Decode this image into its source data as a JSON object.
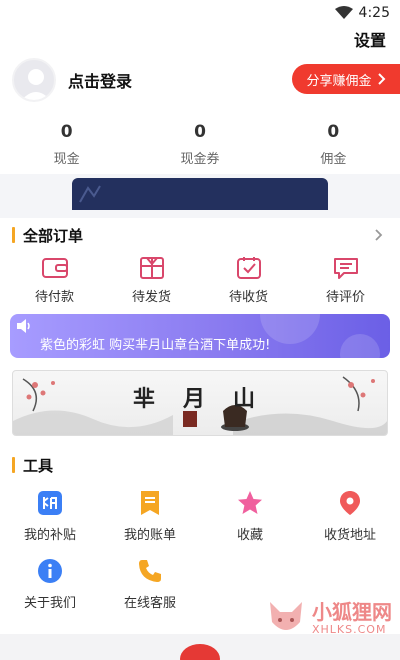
{
  "status_bar": {
    "time": "4:25"
  },
  "header": {
    "settings_label": "设置"
  },
  "profile": {
    "login_label": "点击登录",
    "share_label": "分享赚佣金"
  },
  "stats": [
    {
      "value": "0",
      "label": "现金"
    },
    {
      "value": "0",
      "label": "现金券"
    },
    {
      "value": "0",
      "label": "佣金"
    }
  ],
  "orders": {
    "title": "全部订单",
    "items": [
      {
        "label": "待付款",
        "icon": "wallet-icon"
      },
      {
        "label": "待发货",
        "icon": "gift-box-icon"
      },
      {
        "label": "待收货",
        "icon": "checked-box-icon"
      },
      {
        "label": "待评价",
        "icon": "comment-icon"
      }
    ]
  },
  "notice": {
    "text": "紫色的彩虹 购买芈月山章台酒下单成功!"
  },
  "banner": {
    "title": "芈月山"
  },
  "tools": {
    "title": "工具",
    "items": [
      {
        "label": "我的补贴",
        "icon": "subsidy-icon"
      },
      {
        "label": "我的账单",
        "icon": "bill-icon"
      },
      {
        "label": "收藏",
        "icon": "star-icon"
      },
      {
        "label": "收货地址",
        "icon": "location-pin-icon"
      },
      {
        "label": "关于我们",
        "icon": "info-icon"
      },
      {
        "label": "在线客服",
        "icon": "phone-icon"
      }
    ]
  },
  "watermark": {
    "cn": "小狐狸网",
    "en": "XHLKS.COM"
  },
  "colors": {
    "accent_red": "#f03a2e",
    "order_icon": "#d9476b",
    "section_bar": "#f5a623",
    "notice_purple": "#8a7bf0",
    "banner_dark": "#23305e"
  }
}
